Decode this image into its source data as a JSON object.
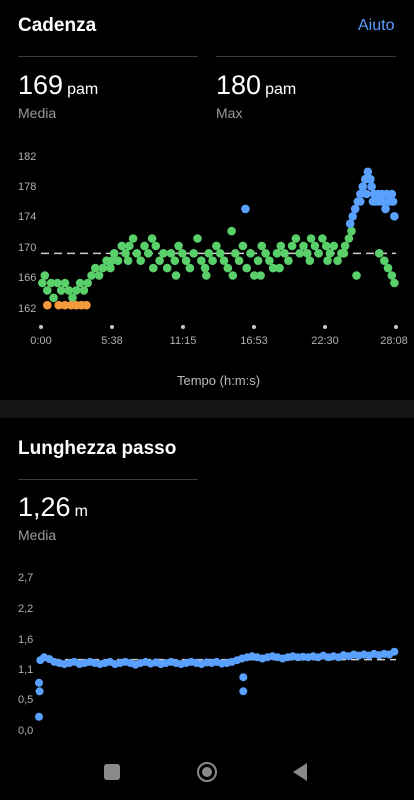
{
  "cadence": {
    "title": "Cadenza",
    "help_label": "Aiuto",
    "avg_value": "169",
    "avg_unit": "pam",
    "avg_label": "Media",
    "max_value": "180",
    "max_unit": "pam",
    "max_label": "Max"
  },
  "stride": {
    "title": "Lunghezza passo",
    "avg_value": "1,26",
    "avg_unit": "m",
    "avg_label": "Media"
  },
  "nav": {
    "square": "square-icon",
    "home": "home-circle-icon",
    "back": "back-triangle-icon"
  },
  "chart_data": [
    {
      "type": "scatter",
      "title": "",
      "xlabel": "Tempo (h:m:s)",
      "ylabel": "",
      "y_ticks": [
        "182",
        "178",
        "174",
        "170",
        "166",
        "162"
      ],
      "x_ticks": [
        "0:00",
        "5:38",
        "11:15",
        "16:53",
        "22:30",
        "28:08"
      ],
      "xlim_minutes": [
        0,
        28.13
      ],
      "ylim": [
        160,
        182
      ],
      "average_line": 169,
      "colors": {
        "low": "#f59a3c",
        "normal": "#5ad06a",
        "high": "#5aa0ff",
        "average": "#cfcfcf"
      },
      "series": [
        {
          "color_key": "normal",
          "points": [
            [
              0.1,
              165
            ],
            [
              0.3,
              166
            ],
            [
              0.5,
              164
            ],
            [
              0.8,
              165
            ],
            [
              1.0,
              163
            ],
            [
              1.3,
              165
            ],
            [
              1.6,
              164
            ],
            [
              1.9,
              165
            ],
            [
              2.2,
              164
            ],
            [
              2.5,
              163
            ],
            [
              2.8,
              164
            ],
            [
              3.1,
              165
            ],
            [
              3.4,
              164
            ],
            [
              3.7,
              165
            ],
            [
              4.0,
              166
            ],
            [
              4.3,
              167
            ],
            [
              4.6,
              166
            ],
            [
              4.9,
              167
            ],
            [
              5.2,
              168
            ],
            [
              5.5,
              167
            ],
            [
              5.8,
              169
            ],
            [
              6.1,
              168
            ],
            [
              6.4,
              170
            ],
            [
              6.7,
              169
            ],
            [
              7.0,
              170
            ],
            [
              7.3,
              171
            ],
            [
              7.6,
              169
            ],
            [
              7.9,
              168
            ],
            [
              8.2,
              170
            ],
            [
              8.5,
              169
            ],
            [
              8.8,
              171
            ],
            [
              9.1,
              170
            ],
            [
              9.4,
              168
            ],
            [
              9.7,
              169
            ],
            [
              10.0,
              167
            ],
            [
              10.3,
              169
            ],
            [
              10.6,
              168
            ],
            [
              10.9,
              170
            ],
            [
              11.2,
              169
            ],
            [
              11.5,
              168
            ],
            [
              11.8,
              167
            ],
            [
              12.1,
              169
            ],
            [
              12.4,
              171
            ],
            [
              12.7,
              168
            ],
            [
              13.0,
              167
            ],
            [
              13.3,
              169
            ],
            [
              13.6,
              168
            ],
            [
              13.9,
              170
            ],
            [
              14.2,
              169
            ],
            [
              14.5,
              168
            ],
            [
              14.8,
              167
            ],
            [
              15.1,
              172
            ],
            [
              15.4,
              169
            ],
            [
              15.7,
              168
            ],
            [
              16.0,
              170
            ],
            [
              16.3,
              167
            ],
            [
              16.6,
              169
            ],
            [
              16.9,
              166
            ],
            [
              17.2,
              168
            ],
            [
              17.5,
              170
            ],
            [
              17.8,
              169
            ],
            [
              18.1,
              168
            ],
            [
              18.4,
              167
            ],
            [
              18.7,
              169
            ],
            [
              19.0,
              170
            ],
            [
              19.3,
              169
            ],
            [
              19.6,
              168
            ],
            [
              19.9,
              170
            ],
            [
              20.2,
              171
            ],
            [
              20.5,
              169
            ],
            [
              20.8,
              170
            ],
            [
              21.1,
              169
            ],
            [
              21.4,
              171
            ],
            [
              21.7,
              170
            ],
            [
              22.0,
              169
            ],
            [
              22.3,
              171
            ],
            [
              22.6,
              170
            ],
            [
              22.9,
              169
            ],
            [
              23.2,
              170
            ],
            [
              23.5,
              168
            ],
            [
              23.8,
              169
            ],
            [
              24.1,
              170
            ],
            [
              24.4,
              171
            ],
            [
              24.6,
              172
            ],
            [
              25.0,
              166
            ],
            [
              26.8,
              169
            ],
            [
              27.2,
              168
            ],
            [
              27.5,
              167
            ],
            [
              27.8,
              166
            ],
            [
              28.0,
              165
            ],
            [
              5.6,
              168
            ],
            [
              6.9,
              168
            ],
            [
              8.9,
              167
            ],
            [
              10.7,
              166
            ],
            [
              13.1,
              166
            ],
            [
              15.2,
              166
            ],
            [
              17.4,
              166
            ],
            [
              18.9,
              167
            ],
            [
              21.3,
              168
            ],
            [
              22.7,
              168
            ],
            [
              24.0,
              169
            ]
          ]
        },
        {
          "color_key": "low",
          "points": [
            [
              0.5,
              162
            ],
            [
              1.4,
              162
            ],
            [
              1.9,
              162
            ],
            [
              2.4,
              162
            ],
            [
              2.8,
              162
            ],
            [
              3.2,
              162
            ],
            [
              3.6,
              162
            ]
          ]
        },
        {
          "color_key": "high",
          "points": [
            [
              16.2,
              175
            ],
            [
              24.5,
              173
            ],
            [
              24.7,
              174
            ],
            [
              24.9,
              175
            ],
            [
              25.1,
              176
            ],
            [
              25.3,
              177
            ],
            [
              25.5,
              178
            ],
            [
              25.7,
              179
            ],
            [
              25.9,
              180
            ],
            [
              26.1,
              179
            ],
            [
              26.2,
              178
            ],
            [
              26.4,
              177
            ],
            [
              26.5,
              176
            ],
            [
              26.7,
              177
            ],
            [
              26.8,
              176
            ],
            [
              27.0,
              177
            ],
            [
              27.1,
              176
            ],
            [
              27.3,
              175
            ],
            [
              27.4,
              177
            ],
            [
              27.6,
              176
            ],
            [
              27.8,
              177
            ],
            [
              27.9,
              176
            ],
            [
              28.0,
              174
            ],
            [
              25.3,
              176
            ],
            [
              25.8,
              177
            ],
            [
              26.3,
              176
            ]
          ]
        }
      ]
    },
    {
      "type": "scatter",
      "title": "",
      "xlabel": "",
      "ylabel": "",
      "y_ticks": [
        "2,7",
        "2,2",
        "1,6",
        "1,1",
        "0,5",
        "0,0"
      ],
      "xlim_minutes": [
        0,
        28.13
      ],
      "ylim": [
        0,
        2.7
      ],
      "average_line": 1.26,
      "colors": {
        "line": "#5aa0ff",
        "average": "#cfcfcf"
      },
      "series": [
        {
          "color_key": "line",
          "points": [
            [
              0.0,
              0.25
            ],
            [
              0.0,
              0.85
            ],
            [
              0.05,
              0.7
            ],
            [
              0.1,
              1.25
            ],
            [
              0.4,
              1.3
            ],
            [
              0.8,
              1.27
            ],
            [
              1.2,
              1.22
            ],
            [
              1.6,
              1.2
            ],
            [
              2.0,
              1.18
            ],
            [
              2.4,
              1.2
            ],
            [
              2.8,
              1.22
            ],
            [
              3.2,
              1.18
            ],
            [
              3.6,
              1.2
            ],
            [
              4.0,
              1.22
            ],
            [
              4.4,
              1.2
            ],
            [
              4.8,
              1.18
            ],
            [
              5.2,
              1.2
            ],
            [
              5.6,
              1.22
            ],
            [
              6.0,
              1.18
            ],
            [
              6.4,
              1.2
            ],
            [
              6.8,
              1.22
            ],
            [
              7.2,
              1.2
            ],
            [
              7.6,
              1.17
            ],
            [
              8.0,
              1.2
            ],
            [
              8.4,
              1.22
            ],
            [
              8.8,
              1.19
            ],
            [
              9.2,
              1.21
            ],
            [
              9.6,
              1.18
            ],
            [
              10.0,
              1.2
            ],
            [
              10.4,
              1.22
            ],
            [
              10.8,
              1.2
            ],
            [
              11.2,
              1.18
            ],
            [
              11.6,
              1.2
            ],
            [
              12.0,
              1.22
            ],
            [
              12.4,
              1.2
            ],
            [
              12.8,
              1.18
            ],
            [
              13.2,
              1.21
            ],
            [
              13.6,
              1.2
            ],
            [
              14.0,
              1.22
            ],
            [
              14.4,
              1.19
            ],
            [
              14.8,
              1.2
            ],
            [
              15.2,
              1.22
            ],
            [
              15.6,
              1.25
            ],
            [
              16.0,
              1.28
            ],
            [
              16.1,
              0.7
            ],
            [
              16.1,
              0.95
            ],
            [
              16.4,
              1.3
            ],
            [
              16.8,
              1.32
            ],
            [
              17.2,
              1.3
            ],
            [
              17.6,
              1.28
            ],
            [
              18.0,
              1.3
            ],
            [
              18.4,
              1.32
            ],
            [
              18.8,
              1.3
            ],
            [
              19.2,
              1.28
            ],
            [
              19.6,
              1.3
            ],
            [
              20.0,
              1.32
            ],
            [
              20.4,
              1.3
            ],
            [
              20.8,
              1.31
            ],
            [
              21.2,
              1.3
            ],
            [
              21.6,
              1.32
            ],
            [
              22.0,
              1.3
            ],
            [
              22.4,
              1.33
            ],
            [
              22.8,
              1.3
            ],
            [
              23.2,
              1.32
            ],
            [
              23.6,
              1.3
            ],
            [
              24.0,
              1.34
            ],
            [
              24.4,
              1.32
            ],
            [
              24.8,
              1.35
            ],
            [
              25.2,
              1.33
            ],
            [
              25.6,
              1.35
            ],
            [
              26.0,
              1.33
            ],
            [
              26.4,
              1.36
            ],
            [
              26.8,
              1.34
            ],
            [
              27.2,
              1.36
            ],
            [
              27.6,
              1.35
            ],
            [
              28.0,
              1.4
            ]
          ]
        }
      ]
    }
  ]
}
